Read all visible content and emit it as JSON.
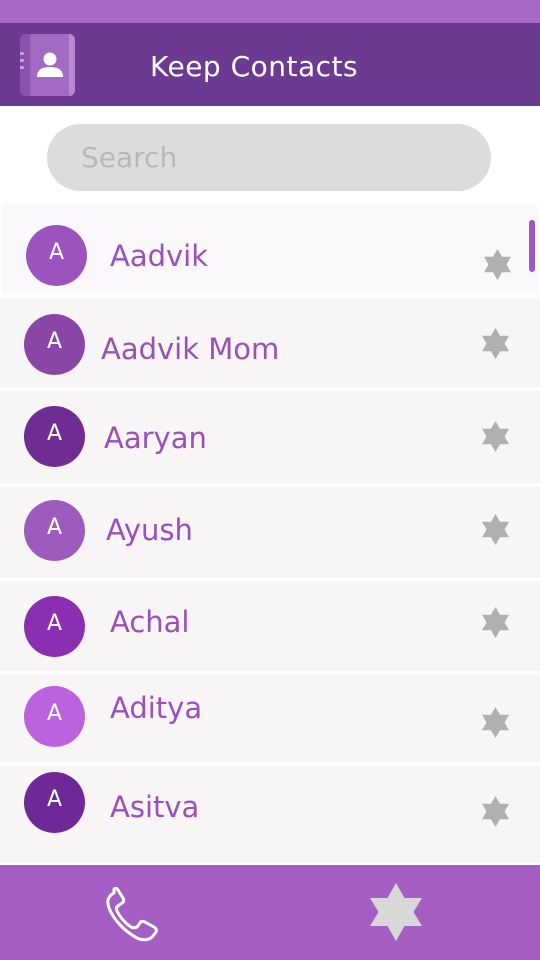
{
  "app": {
    "title": "Keep Contacts"
  },
  "search": {
    "placeholder": "Search"
  },
  "contacts": [
    {
      "initial": "A",
      "name": "Aadvik",
      "color": "#9b54bd"
    },
    {
      "initial": "A",
      "name": "Aadvik Mom",
      "color": "#8a46a7"
    },
    {
      "initial": "A",
      "name": "Aaryan",
      "color": "#6f2d93"
    },
    {
      "initial": "A",
      "name": "Ayush",
      "color": "#9c5bbd"
    },
    {
      "initial": "A",
      "name": "Achal",
      "color": "#8a2fb2"
    },
    {
      "initial": "A",
      "name": "Aditya",
      "color": "#bb62de"
    },
    {
      "initial": "A",
      "name": "Asitva",
      "color": "#6e2898"
    }
  ],
  "icons": {
    "app_icon": "contact-book-icon",
    "favorite": "star-icon",
    "phone": "phone-icon",
    "favorites_tab": "star-icon"
  },
  "colors": {
    "status_bar": "#a868c8",
    "app_bar": "#6d3a91",
    "accent": "#9a4fbb",
    "bottom_bar": "#a55fc4",
    "star": "#b0b0b0"
  }
}
